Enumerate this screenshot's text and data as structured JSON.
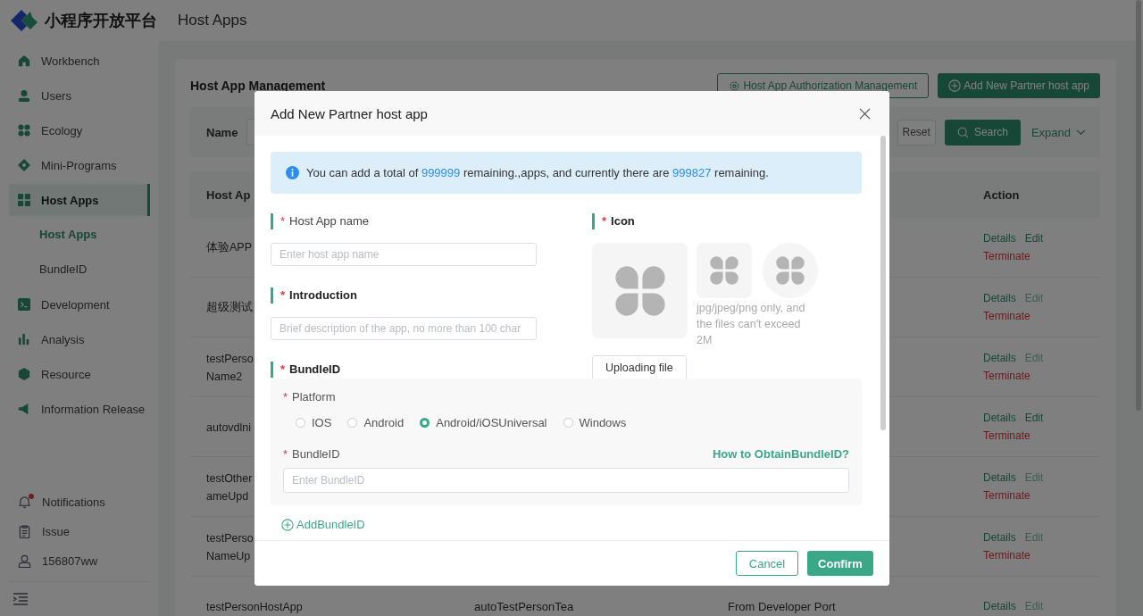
{
  "brand": {
    "title": "小程序开放平台"
  },
  "header": {
    "title": "Host Apps"
  },
  "sidebar": {
    "items": [
      {
        "label": "Workbench",
        "selected": false
      },
      {
        "label": "Users",
        "selected": false
      },
      {
        "label": "Ecology",
        "selected": false
      },
      {
        "label": "Mini-Programs",
        "selected": false
      },
      {
        "label": "Host Apps",
        "selected": true,
        "children": [
          {
            "label": "Host Apps",
            "selected": true
          },
          {
            "label": "BundleID",
            "selected": false
          }
        ]
      },
      {
        "label": "Development",
        "selected": false
      },
      {
        "label": "Analysis",
        "selected": false
      },
      {
        "label": "Resource",
        "selected": false
      },
      {
        "label": "Information Release",
        "selected": false
      }
    ],
    "bottom": [
      {
        "label": "Notifications",
        "unread": true
      },
      {
        "label": "Issue",
        "unread": false
      },
      {
        "label": "156807ww",
        "unread": false
      }
    ]
  },
  "page": {
    "title": "Host App Management",
    "auth_button": "Host App Authorization Management",
    "add_button": "Add New Partner host app",
    "filter": {
      "label": "Name",
      "reset": "Reset",
      "search": "Search",
      "expand": "Expand"
    },
    "table": {
      "columns": [
        "Host Ap",
        "Action"
      ],
      "rows": [
        {
          "name": [
            "体验APP"
          ],
          "details": "Details",
          "edit": "Edit",
          "edit_disabled": false,
          "terminate": "Terminate"
        },
        {
          "name": [
            "超级测试"
          ],
          "details": "Details",
          "edit": "Edit",
          "edit_disabled": true,
          "terminate": "Terminate"
        },
        {
          "name": [
            "testPerso",
            "Name2"
          ],
          "details": "Details",
          "edit": "Edit",
          "edit_disabled": true,
          "terminate": "Terminate"
        },
        {
          "name": [
            "autovdlni"
          ],
          "details": "Details",
          "edit": "Edit",
          "edit_disabled": false,
          "terminate": "Terminate"
        },
        {
          "name": [
            "testOther",
            "ameUpd"
          ],
          "details": "Details",
          "edit": "Edit",
          "edit_disabled": true,
          "terminate": "Terminate"
        },
        {
          "name": [
            "testPerso",
            "NameUp"
          ],
          "details": "Details",
          "edit": "Edit",
          "edit_disabled": true,
          "terminate": "Terminate"
        },
        {
          "name": [
            "testPersonHostApp"
          ],
          "column_2": "autoTestPersonTea",
          "column_3": "From Developer Port",
          "details": "Details",
          "edit": "Edit",
          "edit_disabled": true
        }
      ]
    }
  },
  "modal": {
    "title": "Add New Partner host app",
    "notice": [
      {
        "text": "You can add a total of ",
        "highlight": false
      },
      {
        "text": "999999",
        "highlight": true
      },
      {
        "text": " remaining.,apps, and currently there are ",
        "highlight": false
      },
      {
        "text": "999827",
        "highlight": true
      },
      {
        "text": " remaining.",
        "highlight": false
      }
    ],
    "host_app_name": {
      "required_mark": "*",
      "label": "Host App name",
      "placeholder": "Enter host app name"
    },
    "introduction": {
      "required_mark": "*",
      "label": "Introduction",
      "placeholder": "Brief description of the app, no more than 100 char"
    },
    "bundle_section": {
      "required_mark": "*",
      "label": "BundleID"
    },
    "icon": {
      "required_mark": "*",
      "label": "Icon",
      "hint": "jpg/jpeg/png only, and the files can't exceed 2M",
      "upload": "Uploading file"
    },
    "platform": {
      "required_mark": "*",
      "label": "Platform",
      "options": [
        {
          "label": "IOS",
          "selected": false
        },
        {
          "label": "Android",
          "selected": false
        },
        {
          "label": "Android/iOSUniversal",
          "selected": true
        },
        {
          "label": "Windows",
          "selected": false
        }
      ]
    },
    "bundle_id": {
      "required_mark": "*",
      "label": "BundleID",
      "help_link": "How to ObtainBundleID?",
      "placeholder": "Enter BundleID"
    },
    "add_bundle": "AddBundleID",
    "buttons": {
      "cancel": "Cancel",
      "confirm": "Confirm"
    }
  }
}
